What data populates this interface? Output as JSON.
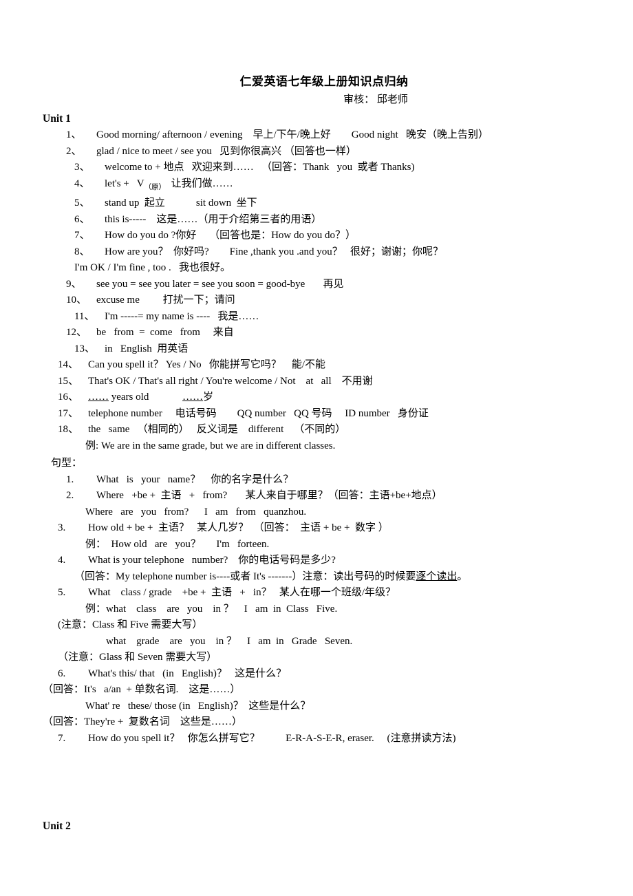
{
  "document": {
    "title": "仁爱英语七年级上册知识点归纳",
    "reviewer": "审核： 邱老师",
    "unit1_heading": "Unit 1",
    "unit2_heading": "Unit 2",
    "sentence_patterns_label": "句型："
  },
  "unit1_points": [
    {
      "num": "1、",
      "text": "Good morning/ afternoon / evening    早上/下午/晚上好        Good night   晚安（晚上告别）",
      "indent": 3
    },
    {
      "num": "2、",
      "text": "glad / nice to meet / see you   见到你很高兴 （回答也一样）",
      "indent": 3
    },
    {
      "num": "3、",
      "text": "welcome to + 地点   欢迎来到……   （回答：Thank   you  或者 Thanks)",
      "indent": 4
    },
    {
      "num": "4、",
      "text": "let's +   V",
      "sub": "（原）",
      "text_after": "  让我们做……",
      "indent": 4
    },
    {
      "num": "5、",
      "text": "stand up  起立            sit down  坐下",
      "indent": 4
    },
    {
      "num": "6、",
      "text": "this is-----    这是……（用于介绍第三者的用语）",
      "indent": 4
    },
    {
      "num": "7、",
      "text": "How do you do ?你好     （回答也是：How do you do？）",
      "indent": 4
    },
    {
      "num": "8、",
      "text": "How are you？  你好吗?        Fine ,thank you .and you？   很好；谢谢；你呢？",
      "indent": 4
    },
    {
      "num": "",
      "text": "I'm OK / I'm fine , too .   我也很好。",
      "indent": 4,
      "continuation": true
    },
    {
      "num": "9、",
      "text": "see you = see you later = see you soon = good-bye       再见",
      "indent": 3
    },
    {
      "num": "10、",
      "text": "excuse me         打扰一下；请问",
      "indent": 3
    },
    {
      "num": "11、",
      "text": "I'm -----= my name is ----   我是……",
      "indent": 4
    },
    {
      "num": "12、",
      "text": "be   from  =  come   from     来自",
      "indent": 3
    },
    {
      "num": "13、",
      "text": "in   English  用英语",
      "indent": 4
    },
    {
      "num": "14、",
      "text": "Can you spell it？ Yes / No   你能拼写它吗？    能/不能",
      "indent": 2
    },
    {
      "num": "15、",
      "text": "That's OK / That's all right / You're welcome / Not    at   all    不用谢",
      "indent": 2
    },
    {
      "num": "16、",
      "underlined_lead": "……",
      "text": " years old             ",
      "underlined_mid": "……",
      "text_tail": "岁",
      "indent": 2
    },
    {
      "num": "17、",
      "text": "telephone number     电话号码        QQ number   QQ 号码     ID number   身份证",
      "indent": 2
    },
    {
      "num": "18、",
      "text": "the   same   （相同的）   反义词是    different    （不同的）",
      "indent": 2
    },
    {
      "num": "",
      "text": "例: We are in the same grade, but we are in different classes.",
      "indent": 5,
      "continuation": true
    }
  ],
  "sentence_patterns": [
    {
      "num": "1.",
      "text": "What   is   your   name？    你的名字是什么？",
      "indent": 3
    },
    {
      "num": "2.",
      "text": "Where   +be +  主语   +   from?       某人来自于哪里？（回答：主语+be+地点）",
      "indent": 3
    },
    {
      "num": "",
      "text": "Where   are   you   from?      I   am   from   quanzhou.",
      "indent": 5,
      "continuation": true
    },
    {
      "num": "3.",
      "text": "How old + be +  主语？   某人几岁？  （回答：  主语 + be +  数字 ）",
      "indent": 2
    },
    {
      "num": "",
      "text": "例：  How old   are   you？      I'm   forteen.",
      "indent": 5,
      "continuation": true
    },
    {
      "num": "4.",
      "text": "What is your telephone   number?    你的电话号码是多少?",
      "indent": 2
    },
    {
      "num": "",
      "text": "（回答：My telephone number is----或者 It's -------）注意：读出号码的时候要",
      "underlined_tail": "逐个读出",
      "text_tail": "。",
      "indent": 4,
      "continuation": true
    },
    {
      "num": "5.",
      "text": "What    class / grade    +be +  主语   +   in？   某人在哪一个班级/年级？",
      "indent": 2
    },
    {
      "num": "",
      "text": "例：what    class    are   you    in ？    I   am  in  Class   Five.",
      "indent": 5,
      "continuation": true
    },
    {
      "num": "",
      "text": "(注意：Class 和 Five 需要大写）",
      "indent": 2,
      "continuation": true
    },
    {
      "num": "",
      "text": "what    grade    are   you    in ？    I   am  in   Grade   Seven.",
      "indent": 7,
      "continuation": true
    },
    {
      "num": "",
      "text": "（注意：Glass 和 Seven 需要大写）",
      "indent": 2,
      "continuation": true
    },
    {
      "num": "6.",
      "text": "What's this/ that   (in   English)？   这是什么？",
      "indent": 2
    },
    {
      "num": "",
      "text": "（回答：It's   a/an  + 单数名词.    这是……）",
      "indent": 0,
      "continuation": true
    },
    {
      "num": "",
      "text": "What' re   these/ those (in   English)？  这些是什么？",
      "indent": 5,
      "continuation": true
    },
    {
      "num": "",
      "text": "（回答：They're +  复数名词    这些是……）",
      "indent": 0,
      "continuation": true
    },
    {
      "num": "7.",
      "text": "How do you spell it？   你怎么拼写它？          E-R-A-S-E-R, eraser.     (注意拼读方法)",
      "indent": 2
    }
  ]
}
